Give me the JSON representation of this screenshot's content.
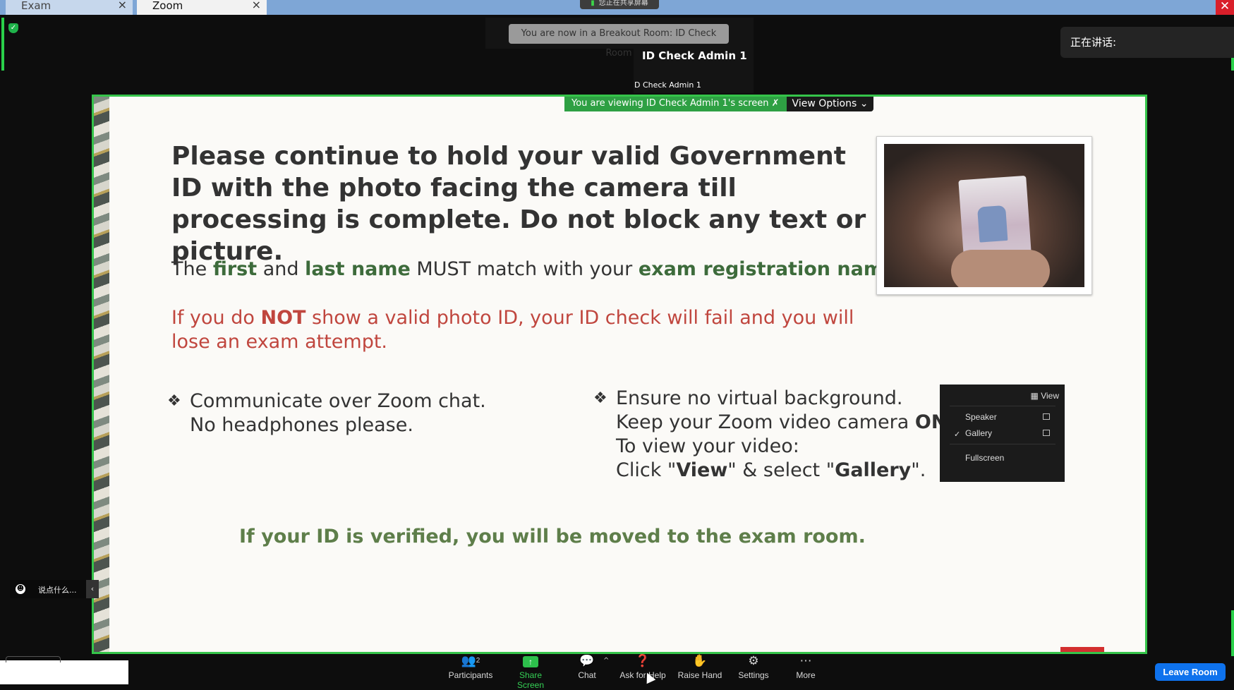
{
  "tabs": [
    {
      "label": "Exam",
      "close": "×"
    },
    {
      "label": "Zoom",
      "close": "×"
    }
  ],
  "share_indicator": "您正在共享屏幕",
  "window_close": "✕",
  "breakout_notice": "You are now in a Breakout Room: ID Check Room",
  "speaker": {
    "name": "ID Check Admin 1",
    "small_label": "D Check Admin 1"
  },
  "talking_label": "正在讲话:",
  "view_bar": {
    "viewing_text": "You are viewing ID Check Admin 1's screen",
    "options_label": "View Options"
  },
  "slide": {
    "headline": "Please continue to hold your valid Government ID with the photo facing the camera till processing is complete. Do not block any text or picture.",
    "name_line": {
      "part1": "The ",
      "first": "first",
      "part2": " and ",
      "last": "last name",
      "part3": " MUST match with your ",
      "reg": "exam registration name",
      "part4": "."
    },
    "warning": {
      "part1": "If you do ",
      "not": "NOT",
      "part2": " show a valid photo ID, your ID check will fail and you will lose an exam attempt."
    },
    "bullet_left": {
      "line1": "Communicate over Zoom chat.",
      "line2": "No headphones please."
    },
    "bullet_right": {
      "line1": "Ensure no virtual background.",
      "line2a": "Keep your Zoom video camera ",
      "line2b": "ON",
      "line2c": ".",
      "line3": "To view your video:",
      "line4a": "Click \"",
      "line4b": "View",
      "line4c": "\" & select \"",
      "line4d": "Gallery",
      "line4e": "\"."
    },
    "bullet_symbol": "❖",
    "verified": "If your ID is verified, you will be moved to the exam room.",
    "view_menu": {
      "title": "View",
      "items": [
        "Speaker",
        "Gallery",
        "Fullscreen"
      ],
      "checked": "✓"
    }
  },
  "chat_overlay": {
    "placeholder": "说点什么...",
    "arrow": "‹"
  },
  "toolbar": {
    "participants": {
      "label": "Participants",
      "count": "2"
    },
    "share": {
      "label": "Share Screen"
    },
    "chat": {
      "label": "Chat"
    },
    "help": {
      "label": "Ask for Help"
    },
    "raise": {
      "label": "Raise Hand"
    },
    "settings": {
      "label": "Settings"
    },
    "more": {
      "label": "More"
    },
    "leave": "Leave Room"
  },
  "colors": {
    "accent_green": "#2ea043",
    "leave_blue": "#0e72ed",
    "highlight_green": "#3d6b3b",
    "warning_red": "#c0463e"
  }
}
